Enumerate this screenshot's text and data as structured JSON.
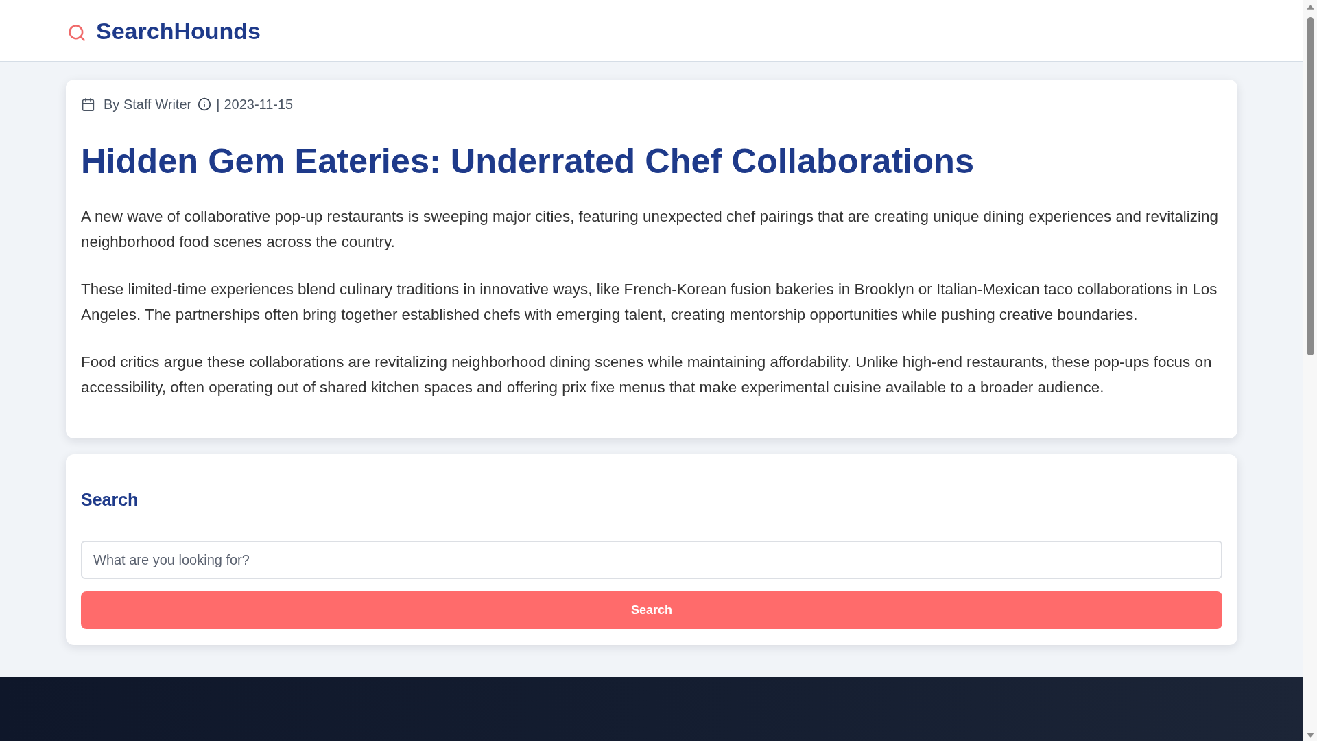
{
  "header": {
    "logo_text": "SearchHounds"
  },
  "article": {
    "author": "By Staff Writer",
    "separator": "|",
    "date": "2023-11-15",
    "title": "Hidden Gem Eateries: Underrated Chef Collaborations",
    "paragraphs": [
      "A new wave of collaborative pop-up restaurants is sweeping major cities, featuring unexpected chef pairings that are creating unique dining experiences and revitalizing neighborhood food scenes across the country.",
      "These limited-time experiences blend culinary traditions in innovative ways, like French-Korean fusion bakeries in Brooklyn or Italian-Mexican taco collaborations in Los Angeles. The partnerships often bring together established chefs with emerging talent, creating mentorship opportunities while pushing creative boundaries.",
      "Food critics argue these collaborations are revitalizing neighborhood dining scenes while maintaining affordability. Unlike high-end restaurants, these pop-ups focus on accessibility, often operating out of shared kitchen spaces and offering prix fixe menus that make experimental cuisine available to a broader audience."
    ]
  },
  "search": {
    "heading": "Search",
    "placeholder": "What are you looking for?",
    "button": "Search"
  }
}
